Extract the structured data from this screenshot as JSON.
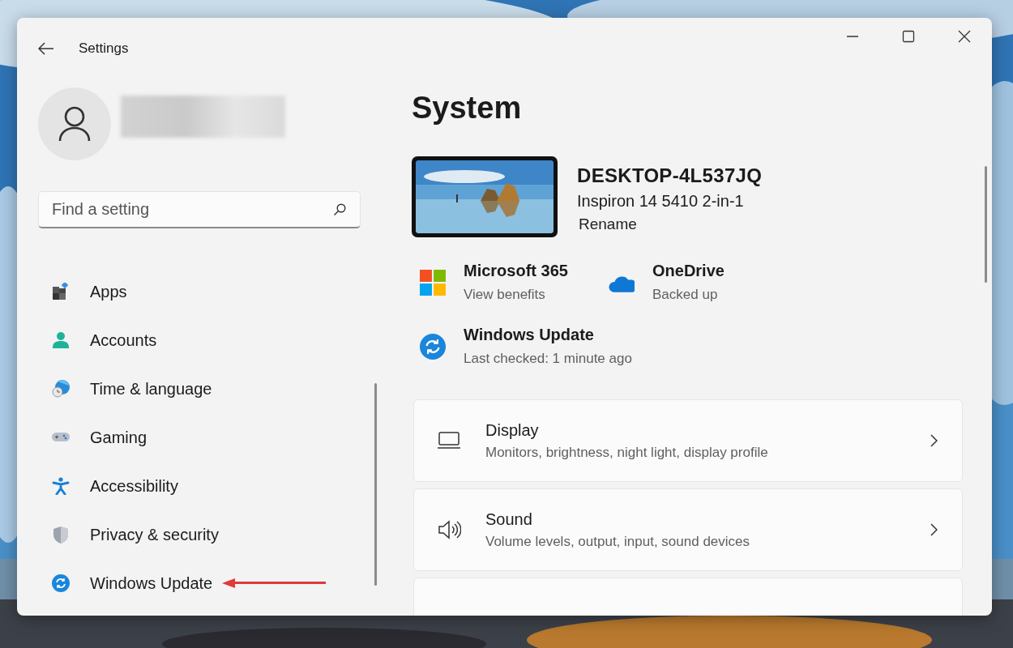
{
  "window": {
    "title": "Settings"
  },
  "sidebar": {
    "search": {
      "placeholder": "Find a setting"
    },
    "items": [
      {
        "label": "Apps",
        "selected": false
      },
      {
        "label": "Accounts",
        "selected": false
      },
      {
        "label": "Time & language",
        "selected": false
      },
      {
        "label": "Gaming",
        "selected": false
      },
      {
        "label": "Accessibility",
        "selected": false
      },
      {
        "label": "Privacy & security",
        "selected": false
      },
      {
        "label": "Windows Update",
        "selected": false
      }
    ]
  },
  "main": {
    "heading": "System",
    "device": {
      "name": "DESKTOP-4L537JQ",
      "model": "Inspiron 14 5410 2-in-1",
      "rename": "Rename"
    },
    "services": [
      {
        "title": "Microsoft 365",
        "subtitle": "View benefits"
      },
      {
        "title": "OneDrive",
        "subtitle": "Backed up"
      },
      {
        "title": "Windows Update",
        "subtitle": "Last checked: 1 minute ago"
      }
    ],
    "cards": [
      {
        "title": "Display",
        "subtitle": "Monitors, brightness, night light, display profile"
      },
      {
        "title": "Sound",
        "subtitle": "Volume levels, output, input, sound devices"
      }
    ]
  }
}
